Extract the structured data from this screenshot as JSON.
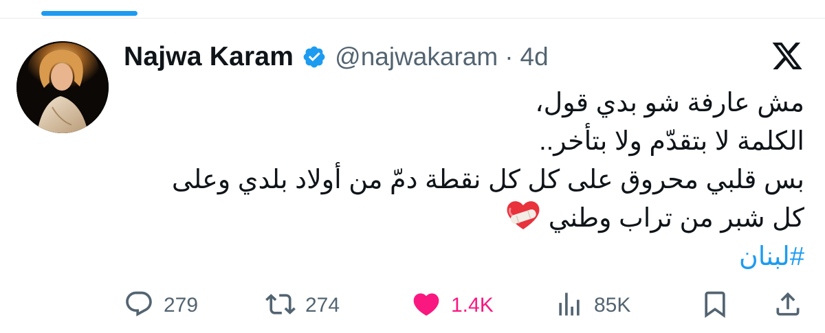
{
  "tweet": {
    "author": {
      "display_name": "Najwa Karam",
      "handle": "@najwakaram",
      "verified": true
    },
    "separator": "·",
    "time": "4d",
    "text_lines": [
      "مش عارفة شو بدي قول،",
      "الكلمة لا بتقدّم ولا بتأخر..",
      "بس قلبي محروق على كل كل نقطة دمّ من أولاد بلدي وعلى",
      "كل شبر من تراب وطني"
    ],
    "emoji": "mending-heart",
    "hashtag": "#لبنان",
    "stats": {
      "replies": "279",
      "retweets": "274",
      "likes": "1.4K",
      "views": "85K"
    }
  },
  "icons": {
    "platform": "x-logo",
    "reply": "comment-icon",
    "retweet": "retweet-icon",
    "like": "heart-icon",
    "views": "views-icon",
    "bookmark": "bookmark-icon",
    "share": "share-icon"
  },
  "colors": {
    "accent": "#1d9bf0",
    "like": "#f91880",
    "text": "#0f1419",
    "muted": "#536471"
  }
}
